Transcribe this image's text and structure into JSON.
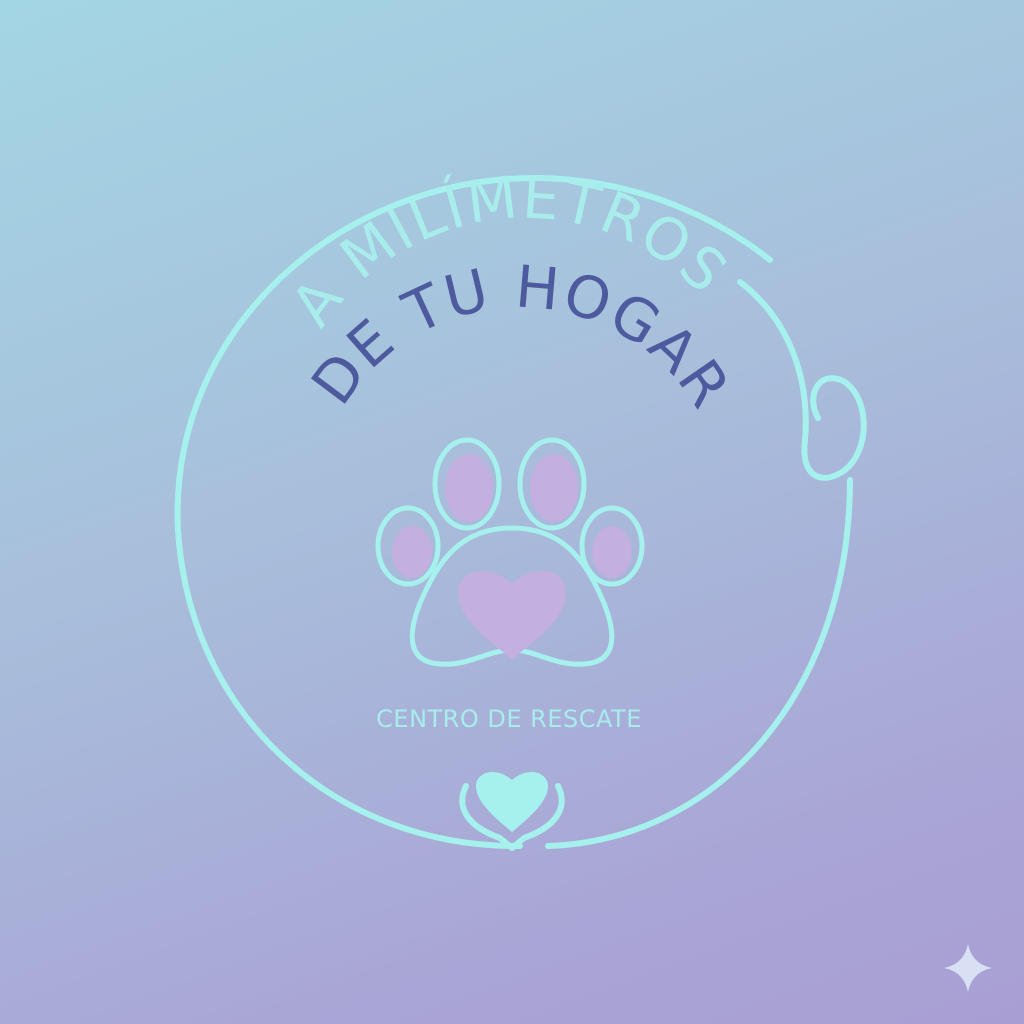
{
  "logo": {
    "title_line1": "A MILÍMETROS",
    "title_line2": "DE TU HOGAR",
    "subtitle": "CENTRO DE RESCATE"
  },
  "colors": {
    "line": "#a6f0ee",
    "title_light": "#a8ecec",
    "title_dark": "#4e5a9e",
    "pad_fill": "#c3afe0",
    "heart_fill": "#a6f0ee",
    "sparkle": "#d9e0f3"
  },
  "icons": {
    "paw": "paw-print-icon",
    "heart": "heart-in-hands-icon",
    "sparkle": "sparkle-icon"
  }
}
